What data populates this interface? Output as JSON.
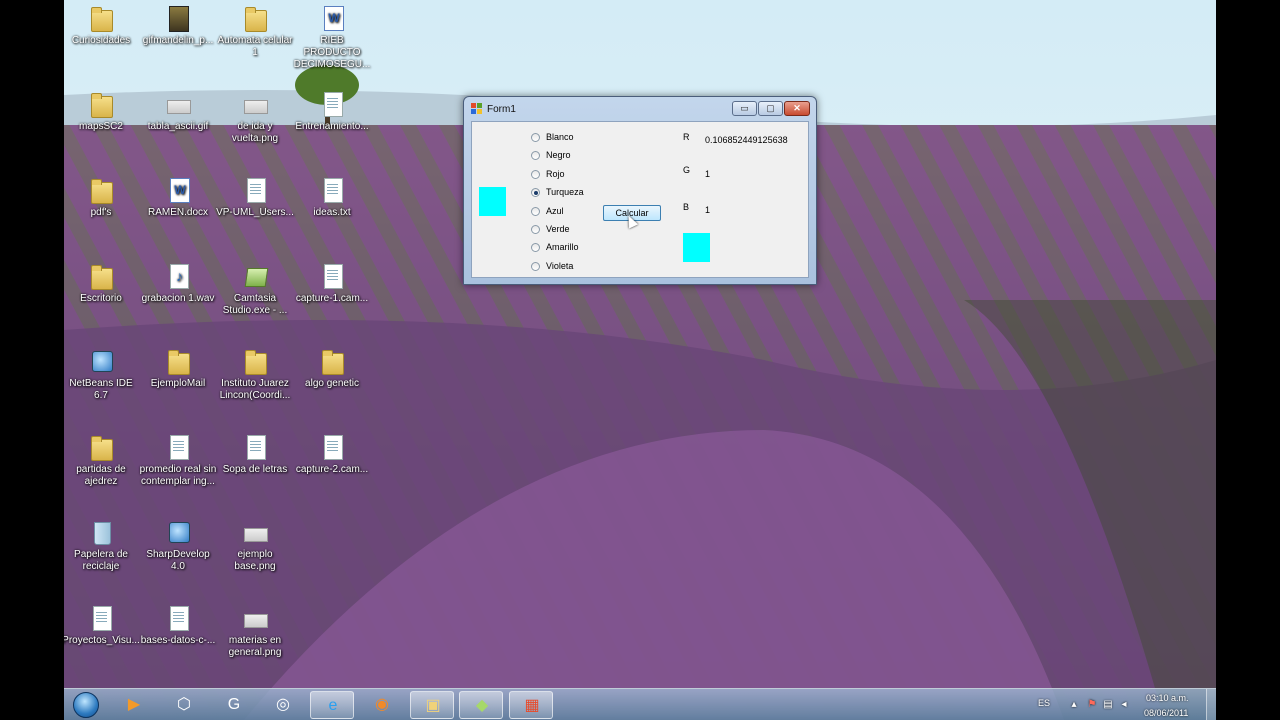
{
  "desktop": {
    "icons": [
      {
        "label": "Curiosidades",
        "kind": "folder"
      },
      {
        "label": "gifmandelin_p...",
        "kind": "picture"
      },
      {
        "label": "Automata celular 1",
        "kind": "folder"
      },
      {
        "label": "RIEB PRODUCTO DECIMOSEGU...",
        "kind": "word"
      },
      {
        "label": "mapsSC2",
        "kind": "folder"
      },
      {
        "label": "tabla_ascii.gif",
        "kind": "img"
      },
      {
        "label": "de ida y vuelta.png",
        "kind": "img"
      },
      {
        "label": "Entrenamiento...",
        "kind": "doc"
      },
      {
        "label": "pdf's",
        "kind": "folder"
      },
      {
        "label": "RAMEN.docx",
        "kind": "word"
      },
      {
        "label": "VP-UML_Users...",
        "kind": "doc"
      },
      {
        "label": "ideas.txt",
        "kind": "doc"
      },
      {
        "label": "Escritorio",
        "kind": "folder"
      },
      {
        "label": "grabacion 1.wav",
        "kind": "audio"
      },
      {
        "label": "Camtasia Studio.exe - ...",
        "kind": "green"
      },
      {
        "label": "capture-1.cam...",
        "kind": "doc"
      },
      {
        "label": "NetBeans IDE 6.7",
        "kind": "app"
      },
      {
        "label": "EjemploMail",
        "kind": "folder"
      },
      {
        "label": "Instituto Juarez Lincon(Coordi...",
        "kind": "folder"
      },
      {
        "label": "algo genetic",
        "kind": "folder"
      },
      {
        "label": "partidas de ajedrez",
        "kind": "folder"
      },
      {
        "label": "promedio real sin contemplar ing...",
        "kind": "doc"
      },
      {
        "label": "Sopa de letras",
        "kind": "doc"
      },
      {
        "label": "capture-2.cam...",
        "kind": "doc"
      },
      {
        "label": "Papelera de reciclaje",
        "kind": "bin"
      },
      {
        "label": "SharpDevelop 4.0",
        "kind": "app"
      },
      {
        "label": "ejemplo base.png",
        "kind": "img"
      },
      {
        "label": "Proyectos_Visu...",
        "kind": "doc"
      },
      {
        "label": "bases-datos-c-...",
        "kind": "doc"
      },
      {
        "label": "materias en general.png",
        "kind": "img"
      }
    ]
  },
  "form1": {
    "title": "Form1",
    "min_glyph": "▭",
    "max_glyph": "▢",
    "close_glyph": "✕",
    "options": [
      {
        "label": "Blanco",
        "checked": false
      },
      {
        "label": "Negro",
        "checked": false
      },
      {
        "label": "Rojo",
        "checked": false
      },
      {
        "label": "Turqueza",
        "checked": true
      },
      {
        "label": "Azul",
        "checked": false
      },
      {
        "label": "Verde",
        "checked": false
      },
      {
        "label": "Amarillo",
        "checked": false
      },
      {
        "label": "Violeta",
        "checked": false
      }
    ],
    "calculate_label": "Calcular",
    "r_label": "R",
    "r_value": "0.106852449125638",
    "g_label": "G",
    "g_value": "1",
    "b_label": "B",
    "b_value": "1",
    "selected_color": "#00ffff",
    "result_color": "#00ffff"
  },
  "taskbar": {
    "pinned": [
      {
        "name": "media-player-icon",
        "glyph": "▶",
        "color": "#f39a2a"
      },
      {
        "name": "unity-icon",
        "glyph": "⬡",
        "color": "#ffffff"
      },
      {
        "name": "green-app-icon",
        "glyph": "G",
        "color": "#ffffff"
      },
      {
        "name": "safari-icon",
        "glyph": "◎",
        "color": "#ffffff"
      },
      {
        "name": "ie-icon",
        "glyph": "e",
        "color": "#2aa0f0"
      },
      {
        "name": "blender-icon",
        "glyph": "◉",
        "color": "#f08a2a"
      },
      {
        "name": "explorer-icon",
        "glyph": "▣",
        "color": "#f0d27a"
      },
      {
        "name": "camtasia-icon",
        "glyph": "◆",
        "color": "#a6d86a"
      },
      {
        "name": "form-app-icon",
        "glyph": "▦",
        "color": "#e84a2a"
      }
    ],
    "language": "ES",
    "time": "03:10 a.m.",
    "date": "08/06/2011"
  }
}
